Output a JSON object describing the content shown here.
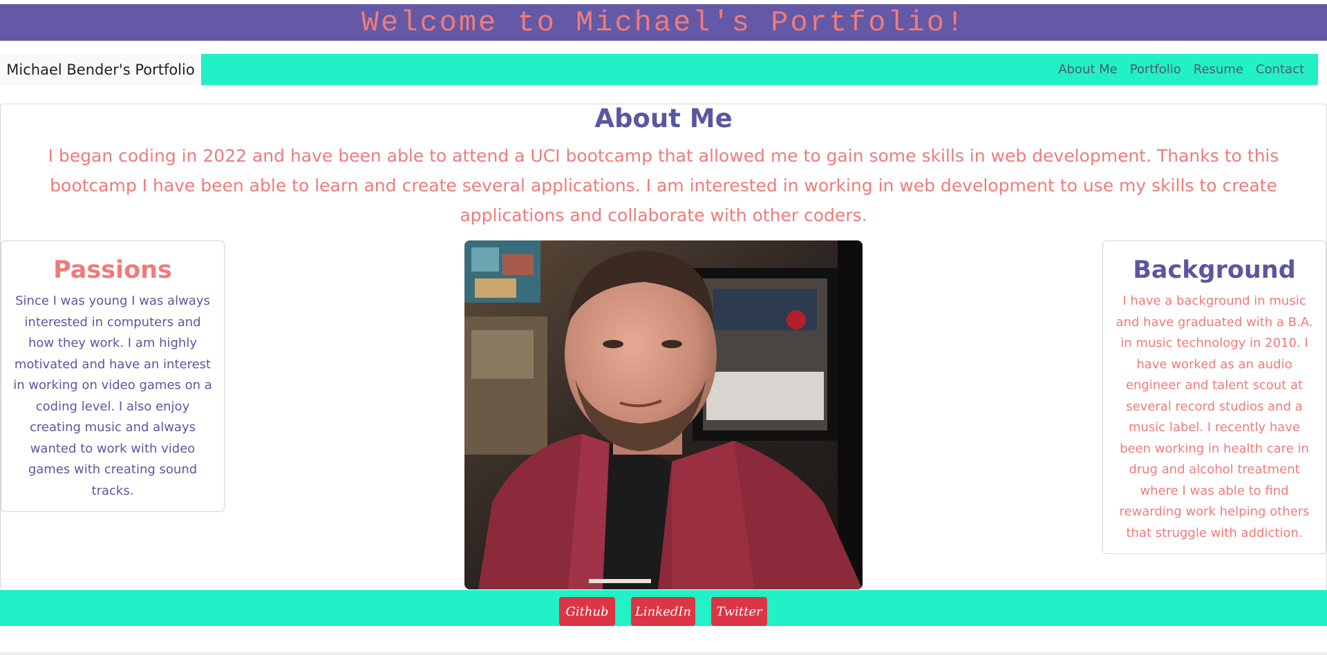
{
  "banner": {
    "title": "Welcome to Michael's Portfolio!"
  },
  "nav": {
    "brand": "Michael Bender's Portfolio",
    "links": [
      "About Me",
      "Portfolio",
      "Resume",
      "Contact"
    ]
  },
  "about": {
    "title": "About Me",
    "text": "I began coding in 2022 and have been able to attend a UCI bootcamp that allowed me to gain some skills in web development. Thanks to this bootcamp I have been able to learn and create several applications. I am interested in working in web development to use my skills to create applications and collaborate with other coders."
  },
  "passions": {
    "title": "Passions",
    "text": "Since I was young I was always interested in computers and how they work. I am highly motivated and have an interest in working on video games on a coding level. I also enjoy creating music and always wanted to work with video games with creating sound tracks."
  },
  "background": {
    "title": "Background",
    "text": "I have a background in music and have graduated with a B.A. in music technology in 2010. I have worked as an audio engineer and talent scout at several record studios and a music label. I recently have been working in health care in drug and alcohol treatment where I was able to find rewarding work helping others that struggle with addiction."
  },
  "footer": {
    "buttons": [
      "Github",
      "LinkedIn",
      "Twitter"
    ]
  },
  "colors": {
    "banner": "#6459a6",
    "accent": "#22f0c6",
    "pink": "#ef7b7b",
    "purple": "#5a57a0",
    "button": "#dc3545"
  }
}
